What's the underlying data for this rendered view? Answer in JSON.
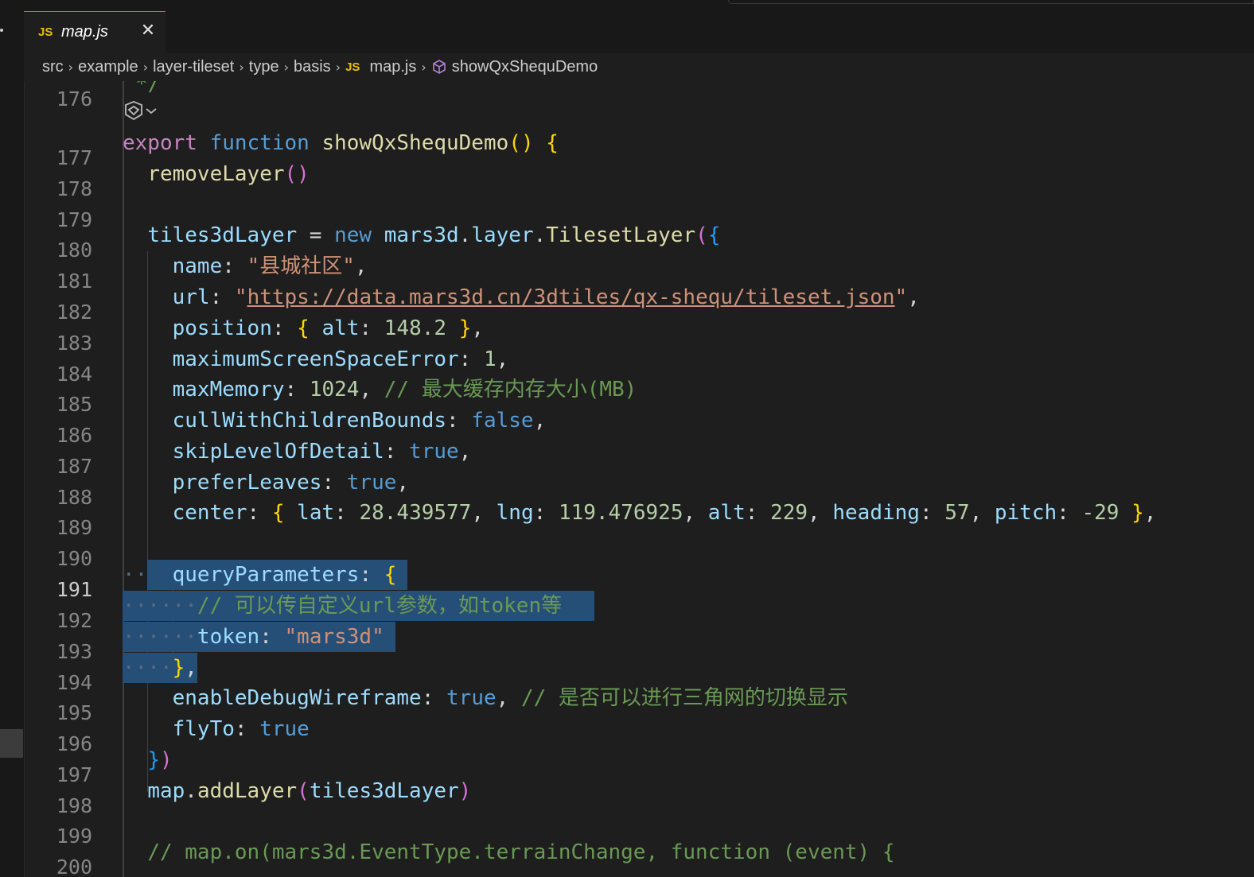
{
  "tab": {
    "badge": "JS",
    "filename": "map.js",
    "close": "✕"
  },
  "breadcrumb": {
    "parts": [
      "src",
      "example",
      "layer-tileset",
      "type",
      "basis"
    ],
    "file_badge": "JS",
    "file": "map.js",
    "symbol": "showQxShequDemo"
  },
  "top_line": {
    "number": "176",
    "text": "*/"
  },
  "lines": [
    {
      "n": "177"
    },
    {
      "n": "178"
    },
    {
      "n": "179"
    },
    {
      "n": "180"
    },
    {
      "n": "181"
    },
    {
      "n": "182"
    },
    {
      "n": "183"
    },
    {
      "n": "184"
    },
    {
      "n": "185"
    },
    {
      "n": "186"
    },
    {
      "n": "187"
    },
    {
      "n": "188"
    },
    {
      "n": "189"
    },
    {
      "n": "190"
    },
    {
      "n": "191"
    },
    {
      "n": "192"
    },
    {
      "n": "193"
    },
    {
      "n": "194"
    },
    {
      "n": "195"
    },
    {
      "n": "196"
    },
    {
      "n": "197"
    },
    {
      "n": "198"
    },
    {
      "n": "199"
    },
    {
      "n": "200"
    }
  ],
  "code": {
    "l177": {
      "export": "export",
      "function": "function",
      "name": "showQxShequDemo",
      "po": "(",
      "pc": ")",
      "brace": "{"
    },
    "l178": {
      "call": "removeLayer",
      "po": "(",
      "pc": ")"
    },
    "l180": {
      "var": "tiles3dLayer",
      "eq": " = ",
      "new": "new",
      "ns": "mars3d",
      "dot1": ".",
      "layer": "layer",
      "dot2": ".",
      "cls": "TilesetLayer",
      "po": "(",
      "bo": "{"
    },
    "l181": {
      "key": "name",
      "colon": ": ",
      "val": "\"县城社区\"",
      "comma": ","
    },
    "l182": {
      "key": "url",
      "colon": ": ",
      "q1": "\"",
      "val": "https://data.mars3d.cn/3dtiles/qx-shequ/tileset.json",
      "q2": "\"",
      "comma": ","
    },
    "l183": {
      "key": "position",
      "colon": ": ",
      "bo": "{",
      "k2": " alt",
      "c2": ": ",
      "v2": "148.2",
      "bc": " }",
      "comma": ","
    },
    "l184": {
      "key": "maximumScreenSpaceError",
      "colon": ": ",
      "val": "1",
      "comma": ","
    },
    "l185": {
      "key": "maxMemory",
      "colon": ": ",
      "val": "1024",
      "comma": ", ",
      "comment": "// 最大缓存内存大小(MB)"
    },
    "l186": {
      "key": "cullWithChildrenBounds",
      "colon": ": ",
      "val": "false",
      "comma": ","
    },
    "l187": {
      "key": "skipLevelOfDetail",
      "colon": ": ",
      "val": "true",
      "comma": ","
    },
    "l188": {
      "key": "preferLeaves",
      "colon": ": ",
      "val": "true",
      "comma": ","
    },
    "l189": {
      "key": "center",
      "colon": ": ",
      "bo": "{",
      "k1": " lat",
      "v1": "28.439577",
      "k2": "lng",
      "v2": "119.476925",
      "k3": "alt",
      "v3": "229",
      "k4": "heading",
      "v4": "57",
      "k5": "pitch",
      "v5": "-29",
      "bc": "}",
      "comma": ","
    },
    "l191": {
      "key": "queryParameters",
      "colon": ": ",
      "bo": "{"
    },
    "l192": {
      "comment": "// 可以传自定义url参数，如token等"
    },
    "l193": {
      "key": "token",
      "colon": ": ",
      "val": "\"mars3d\""
    },
    "l194": {
      "bc": "}",
      "comma": ","
    },
    "l195": {
      "key": "enableDebugWireframe",
      "colon": ": ",
      "val": "true",
      "comma": ", ",
      "comment": "// 是否可以进行三角网的切换显示"
    },
    "l196": {
      "key": "flyTo",
      "colon": ": ",
      "val": "true"
    },
    "l197": {
      "bc": "}",
      "pc": ")"
    },
    "l198": {
      "obj": "map",
      "dot": ".",
      "call": "addLayer",
      "po": "(",
      "arg": "tiles3dLayer",
      "pc": ")"
    },
    "l200": {
      "comment": "// map.on(mars3d.EventType.terrainChange, function (event) {"
    }
  },
  "colors": {
    "background": "#1e1e1e",
    "selection": "#264f78",
    "keyword": "#569cd6",
    "function": "#dcdcaa",
    "property": "#9cdcfe",
    "string": "#ce9178",
    "number": "#b5cea8",
    "comment": "#6a9955",
    "bracket1": "#ffd700",
    "bracket2": "#da70d6",
    "bracket3": "#179fff"
  },
  "icons": {
    "codelens": "copilot-sparkle-icon",
    "symbol": "method-cube-icon",
    "separator": "chevron-right-icon"
  }
}
